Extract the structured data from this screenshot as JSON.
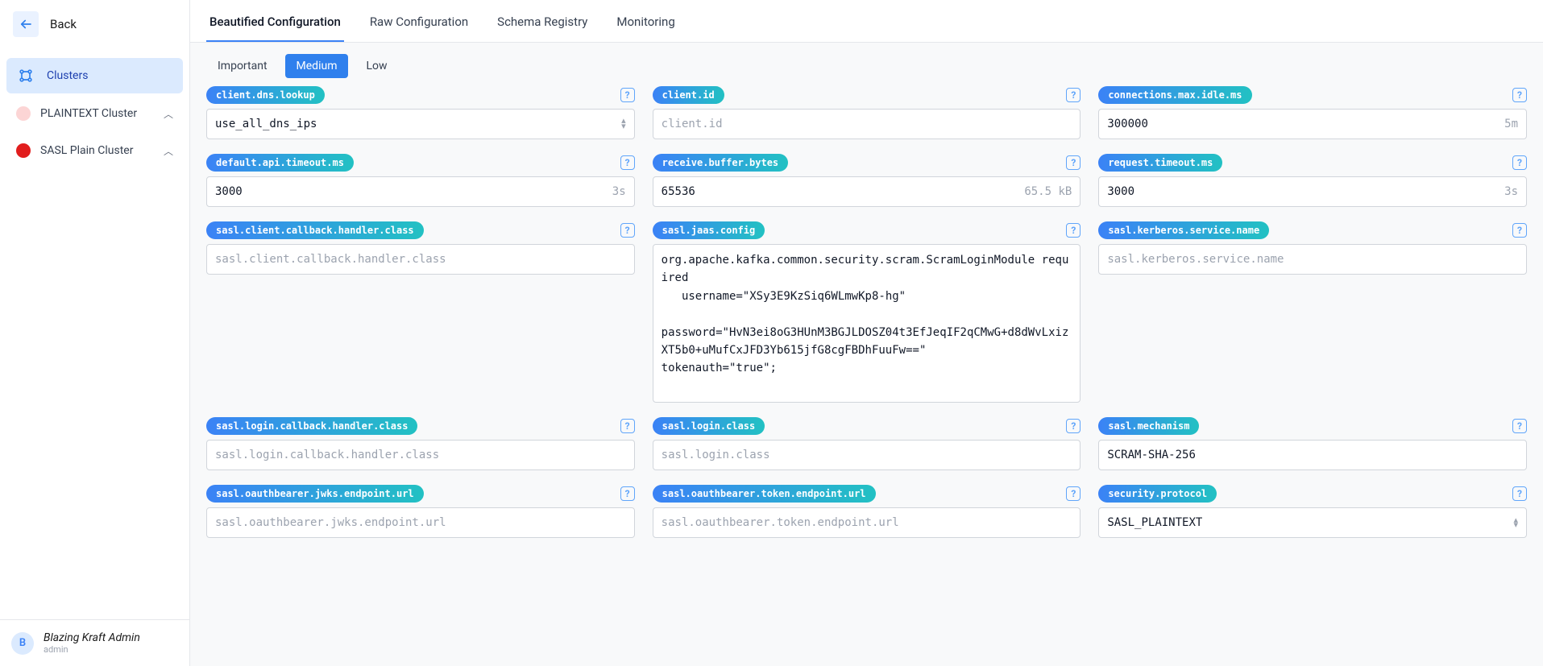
{
  "sidebar": {
    "back_label": "Back",
    "nav": {
      "clusters_label": "Clusters"
    },
    "clusters": [
      {
        "label": "PLAINTEXT Cluster",
        "color": "pink"
      },
      {
        "label": "SASL Plain Cluster",
        "color": "red"
      }
    ],
    "user": {
      "initial": "B",
      "name": "Blazing Kraft Admin",
      "sub": "admin"
    }
  },
  "tabs": [
    {
      "label": "Beautified Configuration",
      "active": true
    },
    {
      "label": "Raw Configuration",
      "active": false
    },
    {
      "label": "Schema Registry",
      "active": false
    },
    {
      "label": "Monitoring",
      "active": false
    }
  ],
  "subtabs": [
    {
      "label": "Important",
      "active": false
    },
    {
      "label": "Medium",
      "active": true
    },
    {
      "label": "Low",
      "active": false
    }
  ],
  "fields": [
    {
      "key": "client.dns.lookup",
      "value": "use_all_dns_ips",
      "type": "select"
    },
    {
      "key": "client.id",
      "value": "",
      "placeholder": "client.id",
      "type": "text"
    },
    {
      "key": "connections.max.idle.ms",
      "value": "300000",
      "suffix": "5m",
      "type": "text"
    },
    {
      "key": "default.api.timeout.ms",
      "value": "3000",
      "suffix": "3s",
      "type": "text"
    },
    {
      "key": "receive.buffer.bytes",
      "value": "65536",
      "suffix": "65.5 kB",
      "type": "text"
    },
    {
      "key": "request.timeout.ms",
      "value": "3000",
      "suffix": "3s",
      "type": "text"
    },
    {
      "key": "sasl.client.callback.handler.class",
      "value": "",
      "placeholder": "sasl.client.callback.handler.class",
      "type": "text"
    },
    {
      "key": "sasl.jaas.config",
      "value": "org.apache.kafka.common.security.scram.ScramLoginModule required\n   username=\"XSy3E9KzSiq6WLmwKp8-hg\"\n\npassword=\"HvN3ei8oG3HUnM3BGJLDOSZ04t3EfJeqIF2qCMwG+d8dWvLxizXT5b0+uMufCxJFD3Yb615jfG8cgFBDhFuuFw==\"\ntokenauth=\"true\";",
      "type": "textarea"
    },
    {
      "key": "sasl.kerberos.service.name",
      "value": "",
      "placeholder": "sasl.kerberos.service.name",
      "type": "text"
    },
    {
      "key": "sasl.login.callback.handler.class",
      "value": "",
      "placeholder": "sasl.login.callback.handler.class",
      "type": "text"
    },
    {
      "key": "sasl.login.class",
      "value": "",
      "placeholder": "sasl.login.class",
      "type": "text"
    },
    {
      "key": "sasl.mechanism",
      "value": "SCRAM-SHA-256",
      "type": "text"
    },
    {
      "key": "sasl.oauthbearer.jwks.endpoint.url",
      "value": "",
      "placeholder": "sasl.oauthbearer.jwks.endpoint.url",
      "type": "text"
    },
    {
      "key": "sasl.oauthbearer.token.endpoint.url",
      "value": "",
      "placeholder": "sasl.oauthbearer.token.endpoint.url",
      "type": "text"
    },
    {
      "key": "security.protocol",
      "value": "SASL_PLAINTEXT",
      "type": "select"
    }
  ]
}
